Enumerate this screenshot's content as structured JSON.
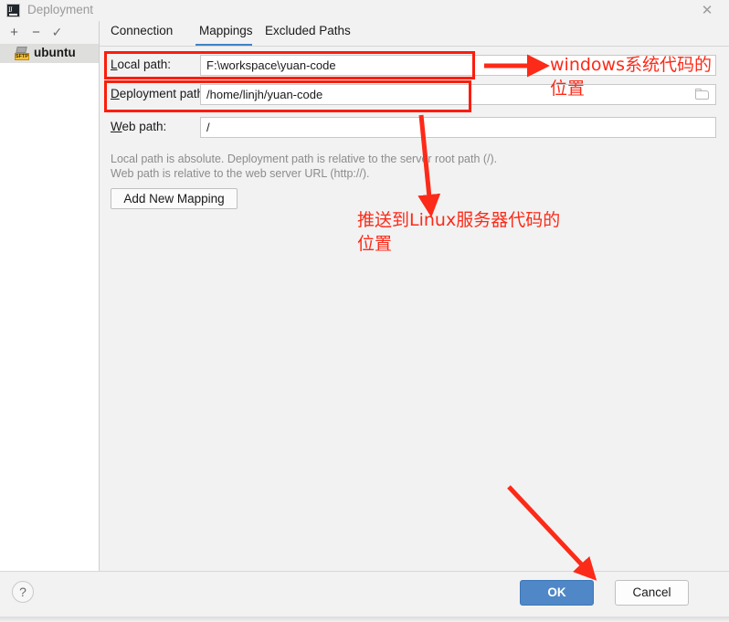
{
  "window": {
    "title": "Deployment",
    "app_icon": "intellij-idea-icon",
    "close_icon": "close-icon"
  },
  "sidebar": {
    "toolbar": [
      {
        "name": "add-server-button",
        "glyph": "+"
      },
      {
        "name": "remove-server-button",
        "glyph": "−"
      },
      {
        "name": "set-default-server-button",
        "glyph": "✓"
      }
    ],
    "items": [
      {
        "label": "ubuntu",
        "badge": "SFTP",
        "selected": true
      }
    ]
  },
  "tabs": [
    {
      "label": "Connection",
      "active": false
    },
    {
      "label": "Mappings",
      "active": true
    },
    {
      "label": "Excluded Paths",
      "active": false
    }
  ],
  "fields": [
    {
      "label": "Local path:",
      "mnemonic": "L",
      "value": "F:\\workspace\\yuan-code",
      "placeholder": "",
      "has_browse": false
    },
    {
      "label": "Deployment path:",
      "mnemonic": "D",
      "value": "/home/linjh/yuan-code",
      "placeholder": "",
      "has_browse": true,
      "browse_icon": "folder-browse-icon"
    },
    {
      "label": "Web path:",
      "mnemonic": "W",
      "value": "/",
      "placeholder": "",
      "has_browse": false
    }
  ],
  "hints": [
    "Local path is absolute. Deployment path is relative to the server root path (/).",
    "Web path is relative to the web server URL (http://)."
  ],
  "add_mapping_button": {
    "label": "Add New Mapping"
  },
  "footer": {
    "help_label": "?",
    "help_icon": "help-icon",
    "ok_label": "OK",
    "cancel_label": "Cancel"
  },
  "annotations": {
    "color": "#fc2a18",
    "items": [
      {
        "name": "annotation-windows-path",
        "text": "windows系统代码的\n位置",
        "target": "local-path-field"
      },
      {
        "name": "annotation-linux-path",
        "text": "推送到Linux服务器代码的\n位置",
        "target": "deployment-path-field"
      }
    ],
    "highlight_boxes": [
      {
        "name": "highlight-local-path-row"
      },
      {
        "name": "highlight-deployment-path-row"
      }
    ],
    "arrows": [
      {
        "name": "arrow-to-local-path"
      },
      {
        "name": "arrow-to-deployment-path"
      },
      {
        "name": "arrow-to-ok-button"
      }
    ]
  }
}
